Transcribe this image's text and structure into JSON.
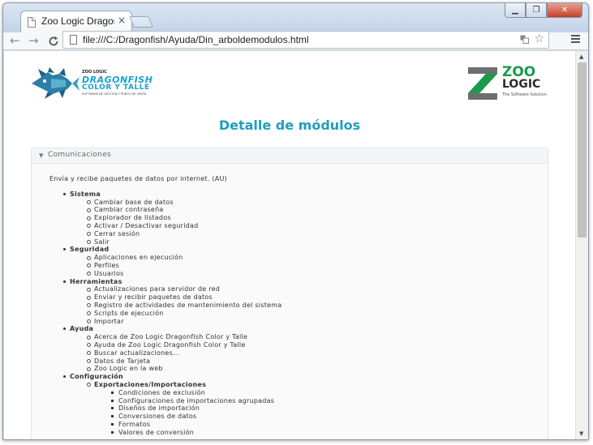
{
  "browser": {
    "tab_title": "Zoo Logic Dragonfis",
    "tab_close": "×",
    "url": "file:///C:/Dragonfish/Ayuda/Din_arboldemodulos.html",
    "win_min": "▁",
    "win_max": "❐",
    "win_close": "✕",
    "back": "←",
    "forward": "→",
    "reload": "C",
    "star": "☆"
  },
  "logos": {
    "dragonfish": {
      "brand_small": "ZOO LOGIC",
      "name": "DRAGONFISH",
      "line2": "COLOR Y TALLE",
      "tagline": "SOFTWARE DE GESTIÓN Y PUNTO DE VENTA"
    },
    "zoologic": {
      "line1": "ZOO",
      "line2": "LOGIC",
      "tagline": "The Software Solution"
    }
  },
  "page": {
    "title": "Detalle de módulos"
  },
  "panel": {
    "title": "Comunicaciones",
    "intro": "Envía y recibe paquetes de datos por internet. (AU)",
    "sections": [
      {
        "label": "Sistema",
        "items": [
          {
            "label": "Cambiar base de datos"
          },
          {
            "label": "Cambiar contraseña"
          },
          {
            "label": "Explorador de listados"
          },
          {
            "label": "Activar / Desactivar seguridad"
          },
          {
            "label": "Cerrar sesión"
          },
          {
            "label": "Salir"
          }
        ]
      },
      {
        "label": "Seguridad",
        "items": [
          {
            "label": "Aplicaciones en ejecución"
          },
          {
            "label": "Perfiles"
          },
          {
            "label": "Usuarios"
          }
        ]
      },
      {
        "label": "Herramientas",
        "items": [
          {
            "label": "Actualizaciones para servidor de red"
          },
          {
            "label": "Enviar y recibir paquetes de datos"
          },
          {
            "label": "Registro de actividades de mantenimiento del sistema"
          },
          {
            "label": "Scripts de ejecución"
          },
          {
            "label": "Importar"
          }
        ]
      },
      {
        "label": "Ayuda",
        "items": [
          {
            "label": "Acerca de Zoo Logic Dragonfish Color y Talle"
          },
          {
            "label": "Ayuda de Zoo Logic Dragonfish Color y Talle"
          },
          {
            "label": "Buscar actualizaciones..."
          },
          {
            "label": "Datos de Tarjeta"
          },
          {
            "label": "Zoo Logic en la web"
          }
        ]
      },
      {
        "label": "Configuración",
        "items": [
          {
            "label": "Exportaciones/Importaciones",
            "bold": true,
            "children": [
              "Condiciones de exclusión",
              "Configuraciones de importaciones agrupadas",
              "Diseños de importación",
              "Conversiones de datos",
              "Formatos",
              "Valores de conversión"
            ]
          }
        ]
      }
    ]
  },
  "colors": {
    "title": "#1e9fbf",
    "zoo_green": "#1a9a4a",
    "zoo_gray": "#6d6e70"
  }
}
